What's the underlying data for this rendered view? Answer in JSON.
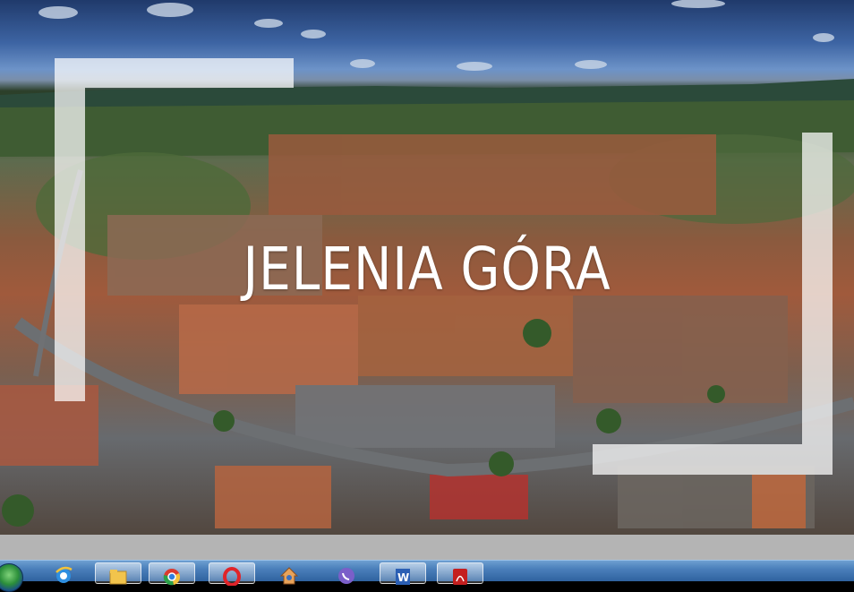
{
  "hero": {
    "title": "JELENIA GÓRA"
  },
  "taskbar": {
    "items": [
      {
        "icon": "internet-explorer-icon"
      },
      {
        "icon": "file-explorer-icon"
      },
      {
        "icon": "chrome-icon"
      },
      {
        "icon": "opera-icon"
      },
      {
        "icon": "home-app-icon"
      },
      {
        "icon": "viber-icon"
      },
      {
        "icon": "word-icon"
      },
      {
        "icon": "pdf-reader-icon"
      }
    ]
  }
}
